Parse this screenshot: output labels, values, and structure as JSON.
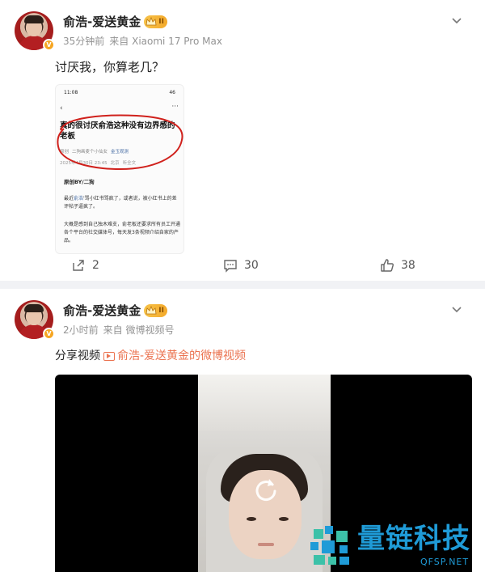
{
  "posts": [
    {
      "username": "俞浩-爱送黄金",
      "vip_level": "II",
      "time": "35分钟前",
      "source": "来自 Xiaomi 17 Pro Max",
      "text": "讨厌我，你算老几？",
      "screenshot": {
        "status_time": "11:08",
        "status_battery": "46",
        "title": "真的很讨厌俞浩这种没有边界感的老板",
        "author": "原创",
        "author_sub": "二狗画麦个小仙女",
        "author_tag": "金玉观测",
        "date": "2025年4月30日 23:45",
        "location": "北京",
        "listen": "听全文",
        "section": "原创BY/二狗",
        "p1_a": "最近",
        "p1_hl": "俞浩",
        "p1_b": "'骂小红书骂疯了，或者说，被小红书上的差评帖子逼疯了。",
        "p2": "大概是感到自己独木难支，俞老板还要求所有员工开通各个平台的社交媒体号，每天发3条视频介绍自家的产品。"
      },
      "shares": "2",
      "comments": "30",
      "likes": "38"
    },
    {
      "username": "俞浩-爱送黄金",
      "vip_level": "II",
      "time": "2小时前",
      "source": "来自 微博视频号",
      "share_label": "分享视频",
      "video_link": "俞浩-爱送黄金的微博视频"
    }
  ],
  "watermark": {
    "text": "量链科技",
    "url": "QFSP.NET"
  },
  "colors": {
    "accent": "#eb7350",
    "watermark": "#1f9bd7",
    "vip_gold": "#f3a92a",
    "circle_red": "#d0211c"
  }
}
